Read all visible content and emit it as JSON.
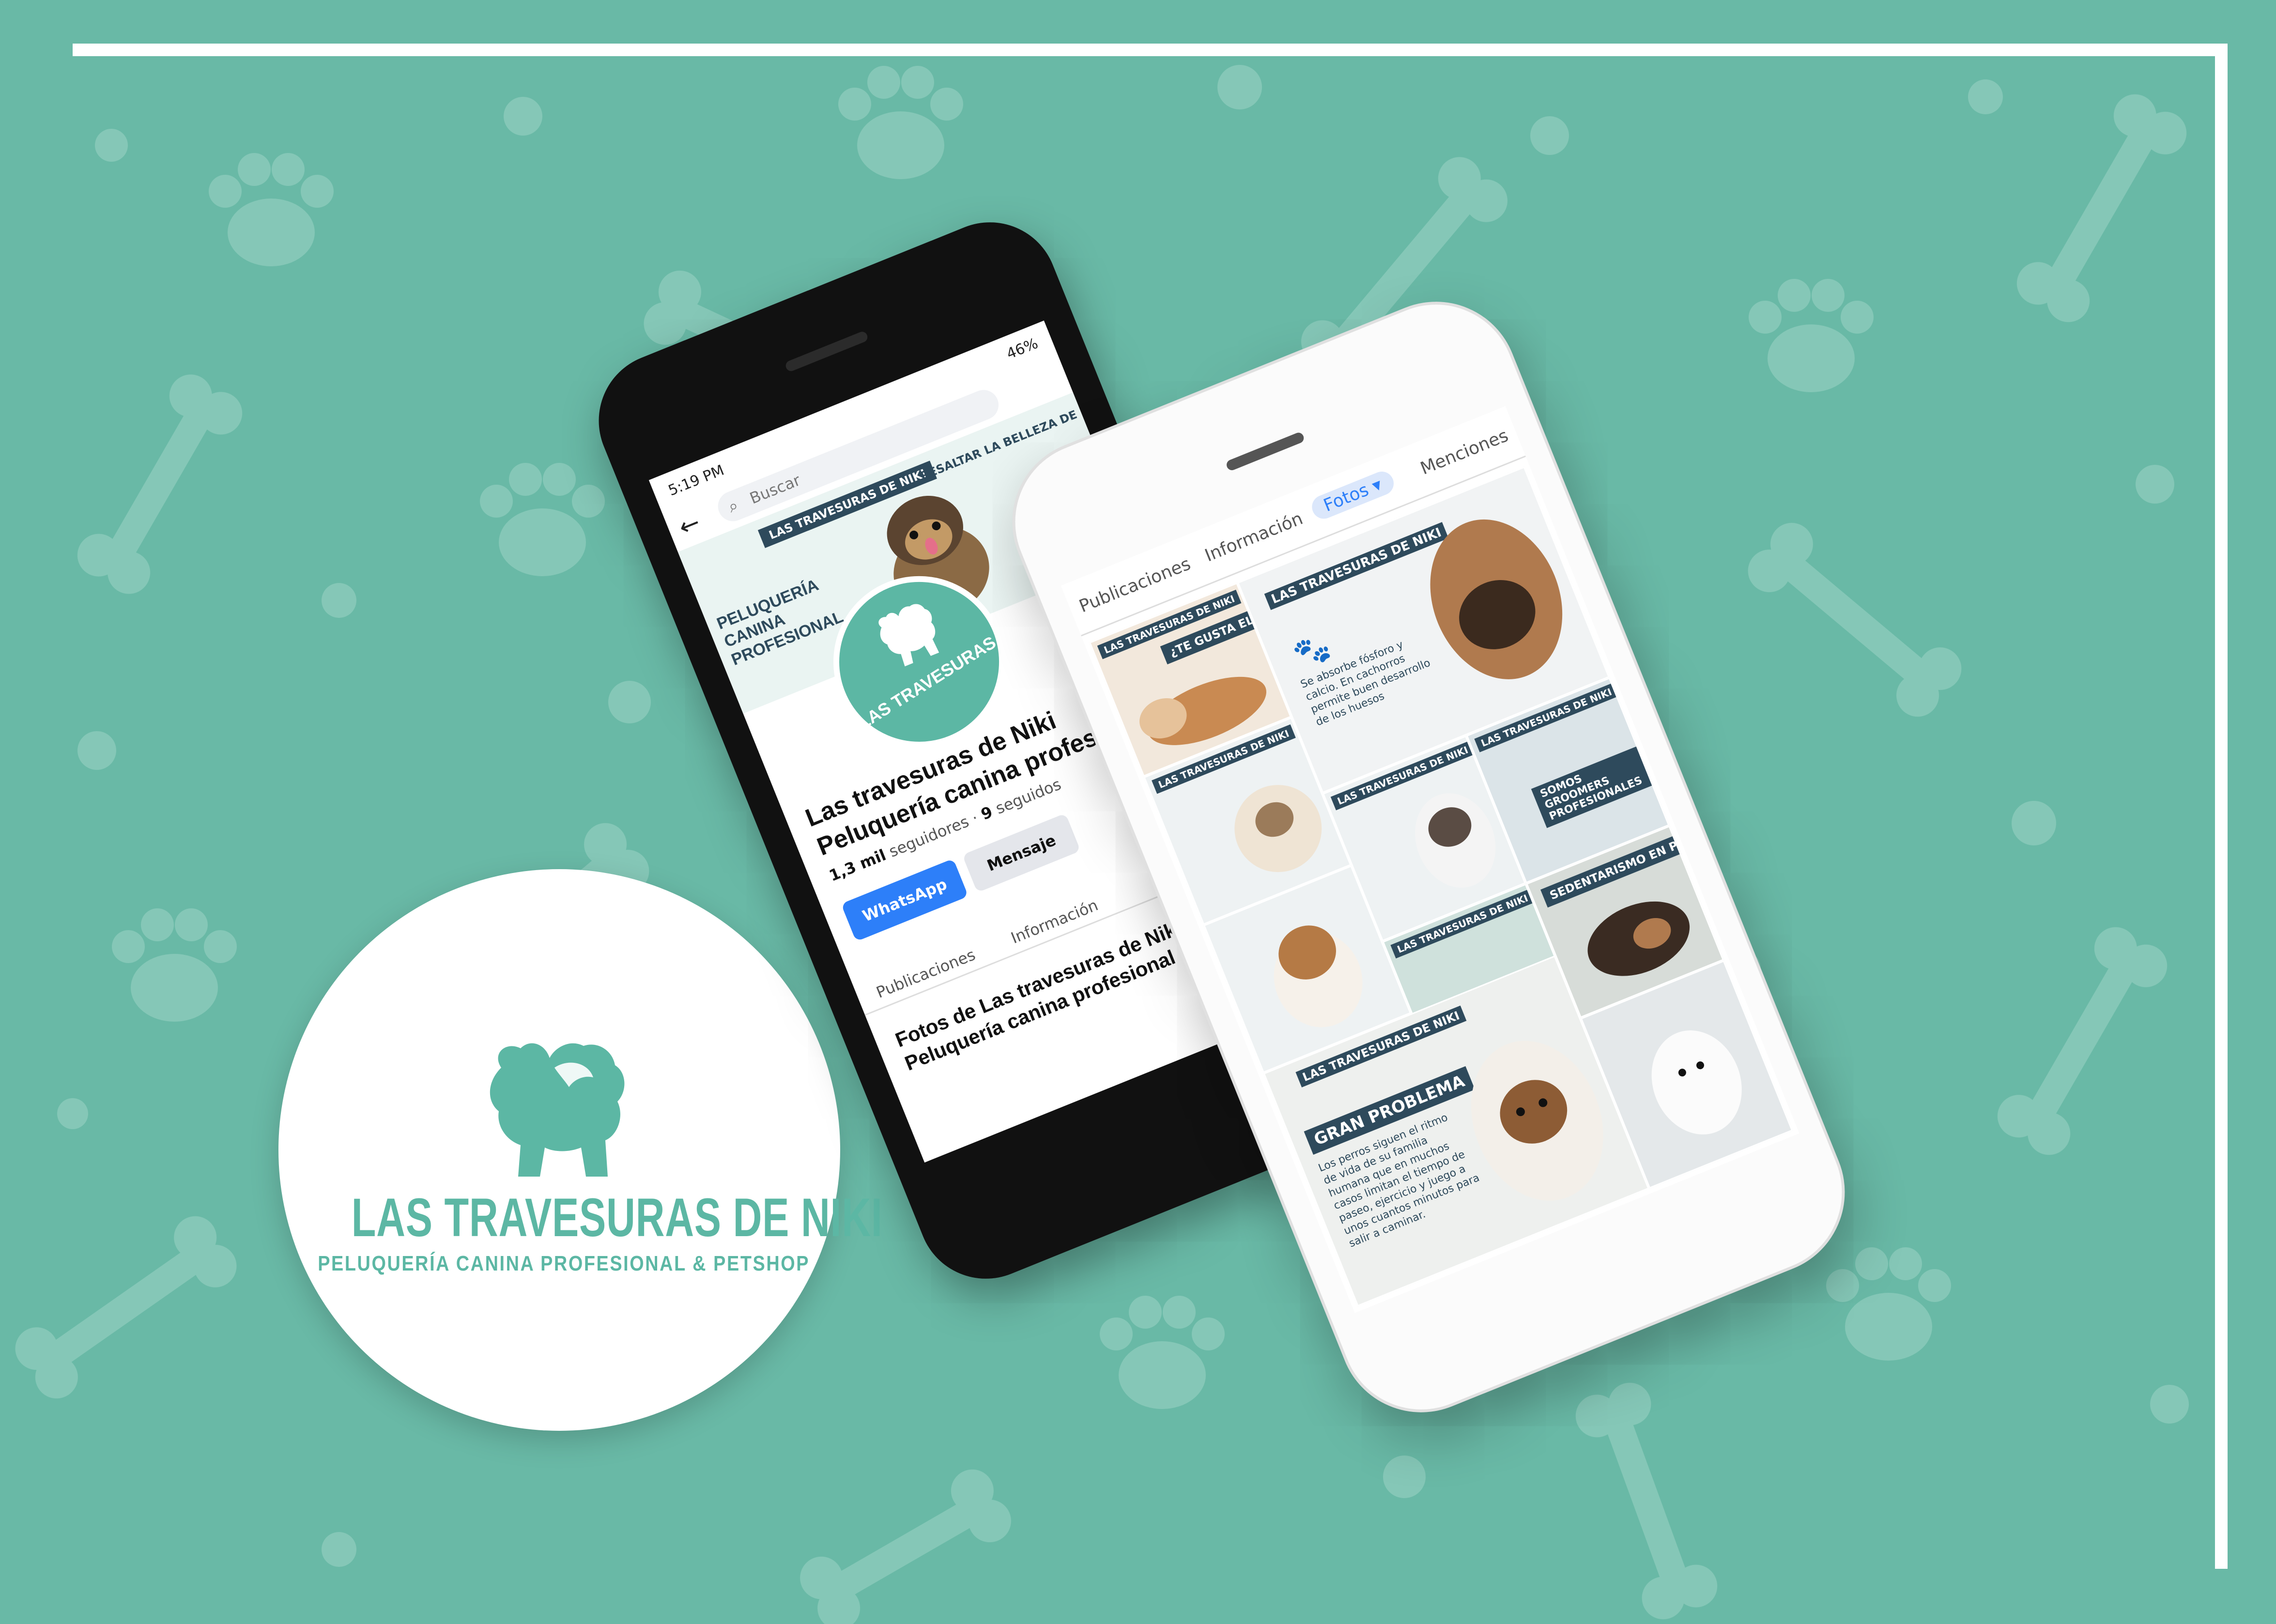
{
  "brand": {
    "name": "LAS TRAVESURAS DE NIKI",
    "tagline": "PELUQUERÍA CANINA PROFESIONAL & PETSHOP",
    "color_primary": "#69b9a6",
    "color_dark": "#2e4a5c"
  },
  "phone_black": {
    "status_time": "5:19 PM",
    "battery": "46%",
    "search_placeholder": "Buscar",
    "back_icon": "arrow-left-icon",
    "cover": {
      "tag": "LAS TRAVESURAS DE NIKI",
      "headline": "PELUQUERÍA CANINA PROFESIONAL",
      "right_text": "RESALTAR LA BELLEZA DE"
    },
    "profile_text": "LAS TRAVESURAS DE NIKI",
    "page_name": "Las travesuras de Niki Peluquería canina profesional",
    "followers_count": "1,3 mil",
    "followers_label": "seguidores",
    "following_count": "9",
    "following_label": "seguidos",
    "buttons": {
      "whatsapp": "WhatsApp",
      "message": "Mensaje"
    },
    "tabs": [
      "Publicaciones",
      "Información"
    ],
    "photos_heading": "Fotos de Las travesuras de Niki Peluquería canina profesional"
  },
  "phone_white": {
    "tabs": [
      "Publicaciones",
      "Información",
      "Fotos",
      "Menciones"
    ],
    "active_tab": "Fotos",
    "tiles": {
      "t1_banner": "LAS TRAVESURAS DE NIKI",
      "t1_head": "¿TE GUSTA EL SOL?",
      "t2_banner": "LAS TRAVESURAS DE NIKI",
      "t2_body": "Se absorbe fósforo y calcio. En cachorros permite buen desarrollo de los huesos",
      "t3_banner": "LAS TRAVESURAS DE NIKI",
      "t4_banner": "LAS TRAVESURAS DE NIKI",
      "t5_banner": "LAS TRAVESURAS DE NIKI",
      "t5_head": "SOMOS GROOMERS PROFESIONALES",
      "t6_head": "SEDENTARISMO EN PERROS",
      "t7_banner": "LAS TRAVESURAS DE NIKI",
      "t8_head": "GRAN PROBLEMA",
      "t8_body": "Los perros siguen el ritmo de vida de su familia humana que en muchos casos limitan el tiempo de paseo, ejercicio y juego a unos cuantos minutos para salir a caminar.",
      "t9_banner": "LAS TRAVESURAS DE NIKI"
    }
  }
}
